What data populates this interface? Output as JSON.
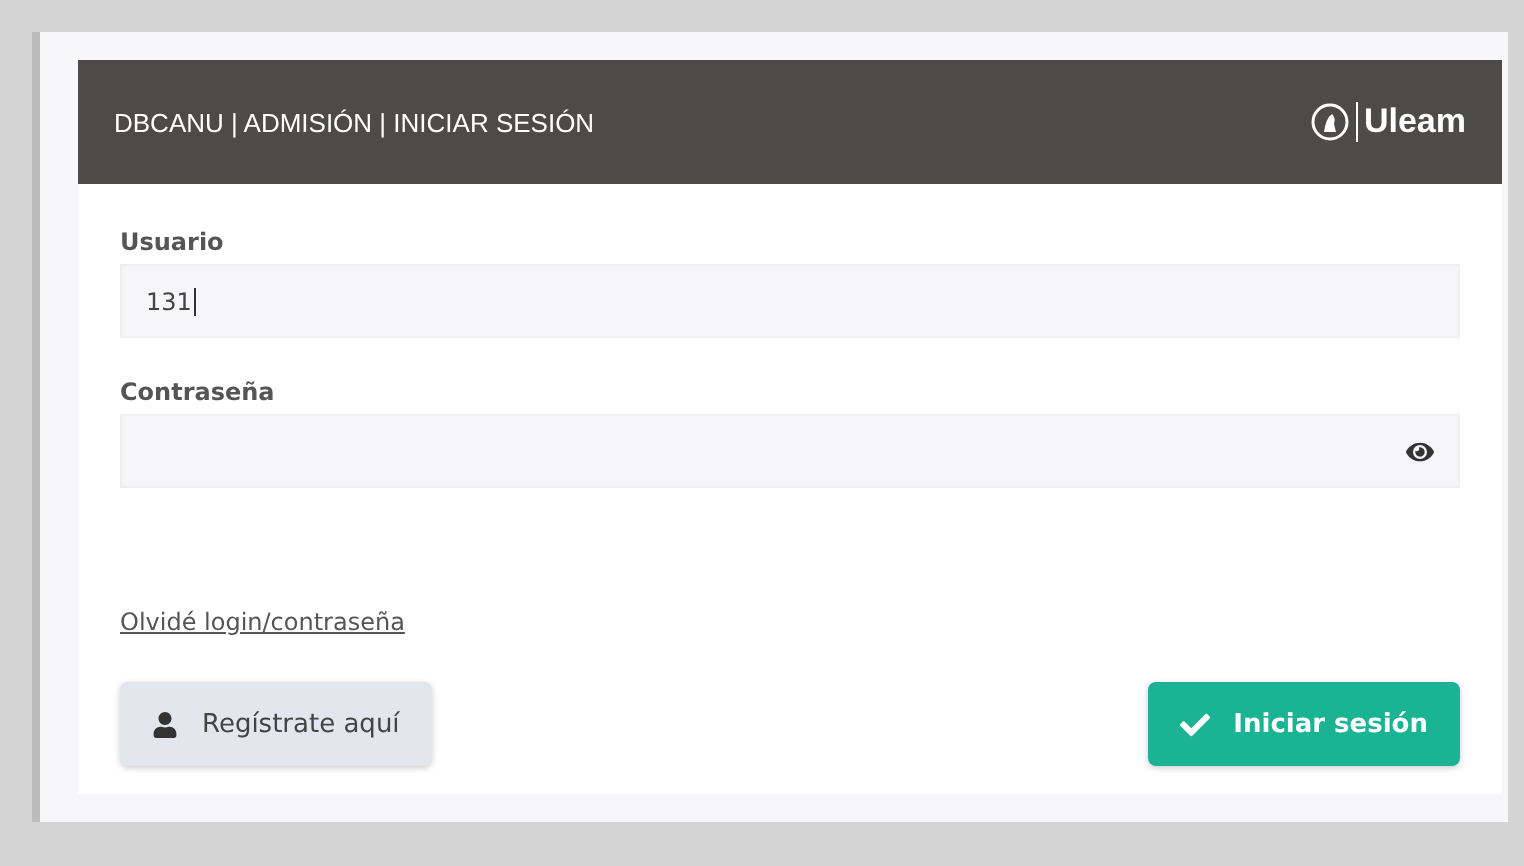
{
  "header": {
    "title": "DBCANU | ADMISIÓN | INICIAR SESIÓN",
    "logo_text": "Uleam"
  },
  "fields": [
    {
      "label": "Usuario",
      "value": "131",
      "kind": "text"
    },
    {
      "label": "Contraseña",
      "kind": "password"
    }
  ],
  "link": "Olvidé login/contraseña",
  "buttons": [
    {
      "label": "Regístrate aquí",
      "kind": "secondary"
    },
    {
      "label": "Iniciar sesión",
      "kind": "primary"
    }
  ]
}
